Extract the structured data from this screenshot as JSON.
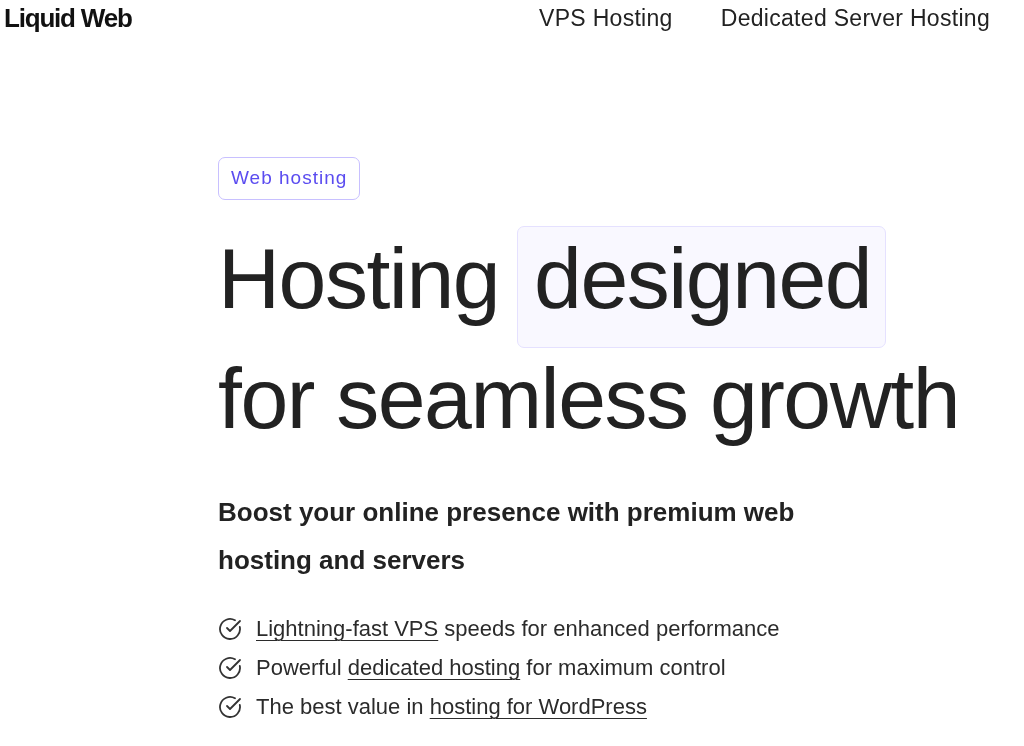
{
  "header": {
    "logo": "Liquid Web",
    "nav": [
      "VPS Hosting",
      "Dedicated Server Hosting"
    ]
  },
  "hero": {
    "badge": "Web hosting",
    "headline": {
      "lead": "Hosting",
      "highlight": "designed",
      "tail": "for seamless growth"
    },
    "subheading": "Boost your online presence with premium web hosting and servers",
    "features": [
      {
        "link": "Lightning-fast VPS",
        "after": " speeds for enhanced performance"
      },
      {
        "before": "Powerful ",
        "link": "dedicated hosting",
        "after": " for maximum control"
      },
      {
        "before": "The best value in ",
        "link": "hosting for WordPress"
      }
    ]
  }
}
